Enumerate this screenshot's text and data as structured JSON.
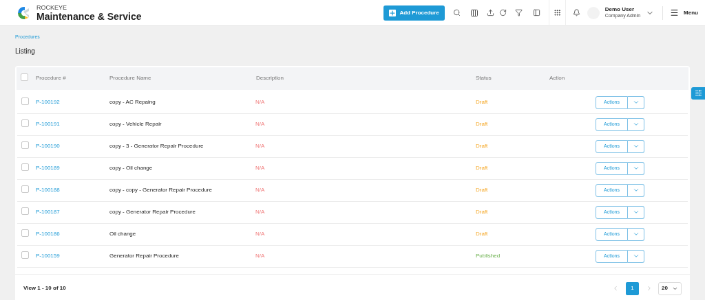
{
  "header": {
    "brand": "ROCKEYE",
    "product": "Maintenance & Service",
    "add_button": "Add Procedure",
    "user_name": "Demo User",
    "user_role": "Company Admin",
    "menu": "Menu"
  },
  "breadcrumb": "Procedures",
  "page_title": "Listing",
  "table": {
    "columns": [
      "Procedure #",
      "Procedure Name",
      "Description",
      "Status",
      "Action"
    ],
    "all_checked": false,
    "rows": [
      {
        "id": "P-100192",
        "name": "copy - AC Repaing",
        "description": "N/A",
        "status": "Draft",
        "kind": "draft",
        "checked": false,
        "action": "Actions"
      },
      {
        "id": "P-100191",
        "name": "copy - Vehicle Repair",
        "description": "N/A",
        "status": "Draft",
        "kind": "draft",
        "checked": false,
        "action": "Actions"
      },
      {
        "id": "P-100190",
        "name": "copy - 3 - Generator Repair Procedure",
        "description": "N/A",
        "status": "Draft",
        "kind": "draft",
        "checked": false,
        "action": "Actions"
      },
      {
        "id": "P-100189",
        "name": "copy - Oil change",
        "description": "N/A",
        "status": "Draft",
        "kind": "draft",
        "checked": false,
        "action": "Actions"
      },
      {
        "id": "P-100188",
        "name": "copy - copy - Generator Repair Procedure",
        "description": "N/A",
        "status": "Draft",
        "kind": "draft",
        "checked": false,
        "action": "Actions"
      },
      {
        "id": "P-100187",
        "name": "copy - Generator Repair Procedure",
        "description": "N/A",
        "status": "Draft",
        "kind": "draft",
        "checked": false,
        "action": "Actions"
      },
      {
        "id": "P-100186",
        "name": "Oil change",
        "description": "N/A",
        "status": "Draft",
        "kind": "draft",
        "checked": false,
        "action": "Actions"
      },
      {
        "id": "P-100159",
        "name": "Generator Repair Procedure",
        "description": "N/A",
        "status": "Published",
        "kind": "published",
        "checked": false,
        "action": "Actions"
      }
    ]
  },
  "footer": {
    "summary": "View 1 - 10 of 10",
    "pages": [
      {
        "label": "1",
        "selected": true
      }
    ],
    "page_size": "20"
  }
}
